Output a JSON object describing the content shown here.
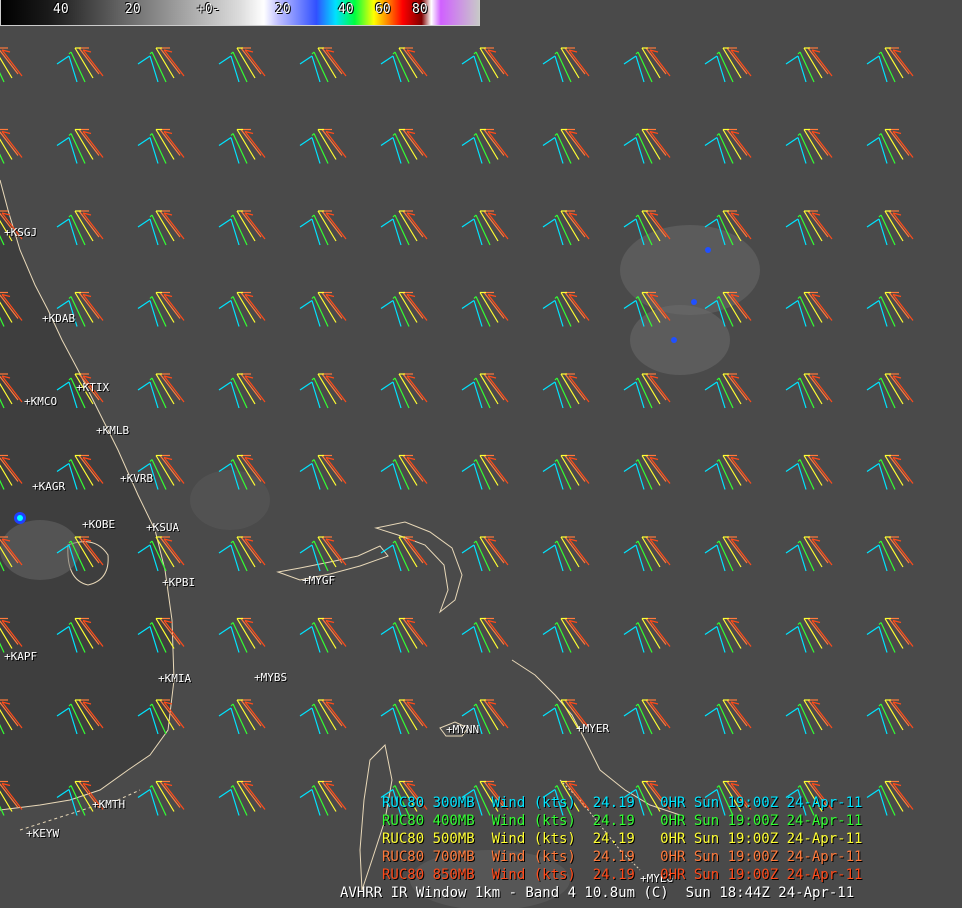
{
  "colorbar": {
    "ticks": [
      "40",
      "20",
      "+0-",
      "20",
      "40",
      "60",
      "80"
    ]
  },
  "stations": [
    {
      "id": "KSGJ"
    },
    {
      "id": "KDAB"
    },
    {
      "id": "KMCO"
    },
    {
      "id": "KTIX"
    },
    {
      "id": "KMLB"
    },
    {
      "id": "KAGR"
    },
    {
      "id": "KVRB"
    },
    {
      "id": "KOBE"
    },
    {
      "id": "KSUA"
    },
    {
      "id": "KPBI"
    },
    {
      "id": "MYGF"
    },
    {
      "id": "KAPF"
    },
    {
      "id": "KMIA"
    },
    {
      "id": "MYBS"
    },
    {
      "id": "MYNN"
    },
    {
      "id": "MYER"
    },
    {
      "id": "KMTH"
    },
    {
      "id": "KEYW"
    },
    {
      "id": "MYEG"
    }
  ],
  "legend": [
    {
      "text": "RUC80 300MB  Wind (kts)  24.19   0HR Sun 19:00Z 24-Apr-11",
      "color": "#00e5ff"
    },
    {
      "text": "RUC80 400MB  Wind (kts)  24.19   0HR Sun 19:00Z 24-Apr-11",
      "color": "#33ff33"
    },
    {
      "text": "RUC80 500MB  Wind (kts)  24.19   0HR Sun 19:00Z 24-Apr-11",
      "color": "#ffff33"
    },
    {
      "text": "RUC80 700MB  Wind (kts)  24.19   0HR Sun 19:00Z 24-Apr-11",
      "color": "#ff7a3c"
    },
    {
      "text": "RUC80 850MB  Wind (kts)  24.19   0HR Sun 19:00Z 24-Apr-11",
      "color": "#ff4a1a"
    }
  ],
  "caption": "AVHRR IR Window 1km - Band 4 10.8um (C)  Sun 18:44Z 24-Apr-11",
  "colors": {
    "wind_300mb": "#00e5ff",
    "wind_400mb": "#33ff33",
    "wind_500mb": "#ffff33",
    "wind_700mb": "#ff7a3c",
    "wind_850mb": "#ff4a1a",
    "coastline": "#e8d8b8",
    "ocean": "#4a4a4a",
    "land": "#3e3e3e"
  }
}
